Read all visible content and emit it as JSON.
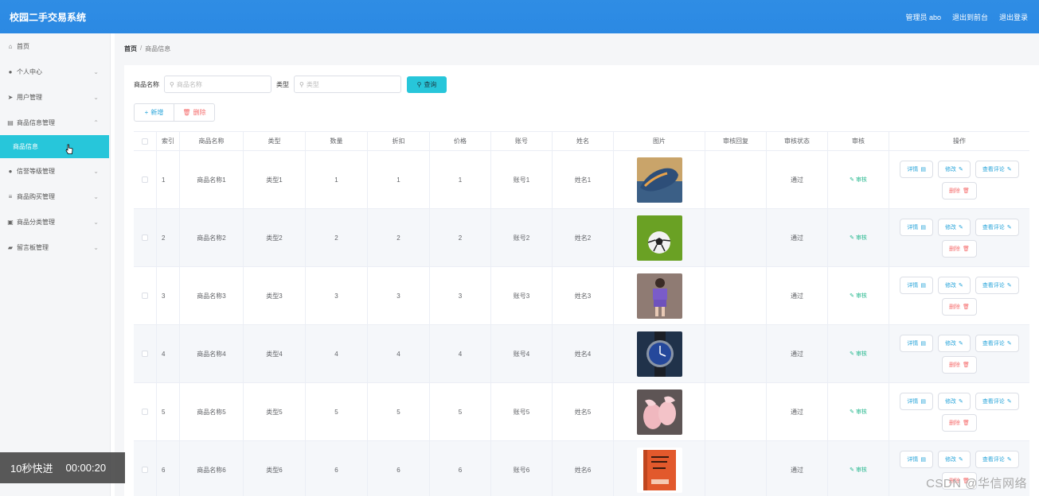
{
  "app": {
    "title": "校园二手交易系统"
  },
  "header": {
    "user": "管理员 abo",
    "back_front": "退出到前台",
    "logout": "退出登录"
  },
  "sidebar": {
    "items": [
      {
        "label": "首页",
        "icon": "home-icon",
        "chevron": false
      },
      {
        "label": "个人中心",
        "icon": "user-icon",
        "chevron": true
      },
      {
        "label": "用户管理",
        "icon": "send-icon",
        "chevron": true
      },
      {
        "label": "商品信息管理",
        "icon": "clipboard-icon",
        "chevron": true,
        "open": true
      },
      {
        "label": "信誉等级管理",
        "icon": "user-icon",
        "chevron": true
      },
      {
        "label": "商品购买管理",
        "icon": "list-icon",
        "chevron": true
      },
      {
        "label": "商品分类管理",
        "icon": "image-icon",
        "chevron": true
      },
      {
        "label": "留言板管理",
        "icon": "briefcase-icon",
        "chevron": true
      }
    ],
    "sub_active": "商品信息"
  },
  "breadcrumb": {
    "home": "首页",
    "sep": "/",
    "current": "商品信息"
  },
  "search": {
    "name_label": "商品名称",
    "name_placeholder": "商品名称",
    "type_label": "类型",
    "type_placeholder": "类型",
    "query_btn": "查询"
  },
  "actions": {
    "add": "新增",
    "delete": "删除"
  },
  "table": {
    "headers": [
      "索引",
      "商品名称",
      "类型",
      "数量",
      "折扣",
      "价格",
      "账号",
      "姓名",
      "图片",
      "审核回复",
      "审核状态",
      "审核",
      "操作"
    ],
    "rows": [
      {
        "idx": "1",
        "name": "商品名称1",
        "type": "类型1",
        "num": "1",
        "discount": "1",
        "price": "1",
        "account": "账号1",
        "person": "姓名1",
        "reply": "",
        "status": "通过",
        "audit": "审核",
        "img": "shoes"
      },
      {
        "idx": "2",
        "name": "商品名称2",
        "type": "类型2",
        "num": "2",
        "discount": "2",
        "price": "2",
        "account": "账号2",
        "person": "姓名2",
        "reply": "",
        "status": "通过",
        "audit": "审核",
        "img": "football"
      },
      {
        "idx": "3",
        "name": "商品名称3",
        "type": "类型3",
        "num": "3",
        "discount": "3",
        "price": "3",
        "account": "账号3",
        "person": "姓名3",
        "reply": "",
        "status": "通过",
        "audit": "审核",
        "img": "outfit"
      },
      {
        "idx": "4",
        "name": "商品名称4",
        "type": "类型4",
        "num": "4",
        "discount": "4",
        "price": "4",
        "account": "账号4",
        "person": "姓名4",
        "reply": "",
        "status": "通过",
        "audit": "审核",
        "img": "watch"
      },
      {
        "idx": "5",
        "name": "商品名称5",
        "type": "类型5",
        "num": "5",
        "discount": "5",
        "price": "5",
        "account": "账号5",
        "person": "姓名5",
        "reply": "",
        "status": "通过",
        "audit": "审核",
        "img": "pink-shoes"
      },
      {
        "idx": "6",
        "name": "商品名称6",
        "type": "类型6",
        "num": "6",
        "discount": "6",
        "price": "6",
        "account": "账号6",
        "person": "姓名6",
        "reply": "",
        "status": "通过",
        "audit": "审核",
        "img": "book"
      }
    ],
    "row_ops": {
      "detail": "详情",
      "edit": "修改",
      "comments": "查看评论",
      "delete": "删除"
    }
  },
  "overlay": {
    "video_label": "10秒快进",
    "video_time": "00:00:20"
  },
  "watermark": "CSDN @华信网络",
  "colors": {
    "header": "#2f8de4",
    "accent": "#27c6da",
    "danger": "#f56c6c",
    "success": "#27b88f"
  }
}
